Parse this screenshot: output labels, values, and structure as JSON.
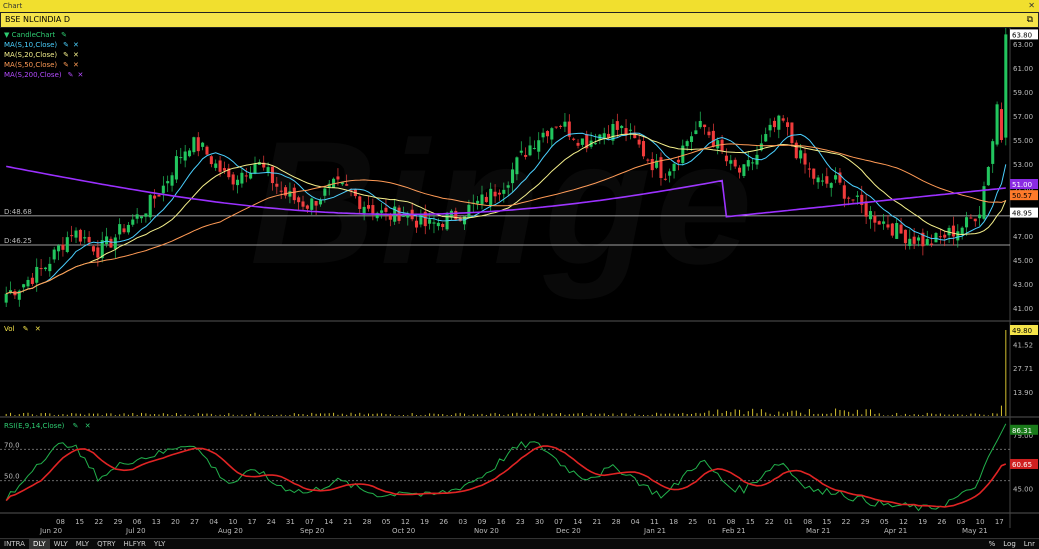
{
  "window": {
    "title": "Chart",
    "close_icon": "close-icon"
  },
  "symbol_bar": {
    "symbol": "BSE NLCINDIA D",
    "menu_icon": "window-menu-icon"
  },
  "watermark": "Binge",
  "price_panel": {
    "legend": [
      {
        "label": "CandleChart",
        "color": "#2ecc71",
        "prefix": "▼"
      },
      {
        "label": "MA(S,10,Close)",
        "color": "#4ad0ff"
      },
      {
        "label": "MA(S,20,Close)",
        "color": "#f5f08c"
      },
      {
        "label": "MA(S,50,Close)",
        "color": "#ff9a55"
      },
      {
        "label": "MA(S,200,Close)",
        "color": "#b44bff"
      }
    ],
    "hlines": [
      {
        "label": "D:48.68",
        "value": 48.68
      },
      {
        "label": "D:46.25",
        "value": 46.25
      }
    ],
    "yticks": [
      "63.00",
      "61.00",
      "59.00",
      "57.00",
      "55.00",
      "53.00",
      "51.00",
      "49.00",
      "47.00",
      "45.00",
      "43.00",
      "41.00"
    ],
    "tags": [
      {
        "text": "63.80",
        "bg": "#ffffff",
        "fg": "#000000"
      },
      {
        "text": "51.00",
        "bg": "#8a2be2",
        "fg": "#ffffff"
      },
      {
        "text": "50.57",
        "bg": "#ff7a2a",
        "fg": "#000000"
      },
      {
        "text": "48.95",
        "bg": "#ffffff",
        "fg": "#000000"
      }
    ]
  },
  "volume_panel": {
    "legend": "Vol",
    "yticks": [
      "41.52",
      "27.71",
      "13.90"
    ],
    "tag": {
      "text": "49.80",
      "bg": "#f5e44a",
      "fg": "#000000"
    }
  },
  "rsi_panel": {
    "legend": "RSI(E,9,14,Close)",
    "levels": [
      {
        "label": "70.0",
        "value": 70
      },
      {
        "label": "50.0",
        "value": 50
      }
    ],
    "yticks": [
      "79.00",
      "45.00"
    ],
    "tags": [
      {
        "text": "86.31",
        "bg": "#1a7a1a",
        "fg": "#ffffff"
      },
      {
        "text": "60.65",
        "bg": "#d02020",
        "fg": "#ffffff"
      }
    ]
  },
  "x_axis": {
    "day_labels": [
      "08",
      "15",
      "22",
      "29",
      "06",
      "13",
      "20",
      "27",
      "04",
      "10",
      "17",
      "24",
      "31",
      "07",
      "14",
      "21",
      "28",
      "05",
      "12",
      "19",
      "26",
      "03",
      "09",
      "16",
      "23",
      "30",
      "07",
      "14",
      "21",
      "28",
      "04",
      "11",
      "18",
      "25",
      "01",
      "08",
      "15",
      "22",
      "01",
      "08",
      "15",
      "22",
      "29",
      "05",
      "12",
      "19",
      "26",
      "03",
      "10",
      "17"
    ],
    "month_labels": [
      "Jun 20",
      "Jul 20",
      "Aug 20",
      "Sep 20",
      "Oct 20",
      "Nov 20",
      "Dec 20",
      "Jan 21",
      "Feb 21",
      "Mar 21",
      "Apr 21",
      "May 21"
    ]
  },
  "bottom_bar": {
    "timeframes": [
      "INTRA",
      "DLY",
      "WLY",
      "MLY",
      "QTRY",
      "HLFYR",
      "YLY"
    ],
    "active": "DLY",
    "right": [
      "%",
      "Log",
      "Lnr"
    ]
  },
  "chart_data": {
    "type": "candlestick",
    "x_range": [
      "Jun 20",
      "May 21"
    ],
    "price_ylim": [
      40.0,
      64.0
    ],
    "moving_averages": [
      "MA(S,10,Close)",
      "MA(S,20,Close)",
      "MA(S,50,Close)",
      "MA(S,200,Close)"
    ],
    "close_series": [
      42.2,
      42.8,
      43.6,
      44.5,
      46.0,
      47.4,
      46.8,
      45.8,
      46.6,
      47.8,
      48.6,
      49.8,
      51.2,
      53.4,
      54.8,
      54.2,
      52.8,
      51.6,
      52.4,
      53.2,
      52.0,
      50.6,
      50.0,
      49.6,
      50.4,
      51.2,
      50.8,
      49.8,
      49.2,
      48.6,
      49.0,
      48.4,
      47.8,
      48.2,
      48.6,
      49.2,
      49.8,
      50.6,
      51.6,
      53.4,
      54.8,
      55.8,
      56.6,
      55.6,
      54.8,
      55.4,
      56.0,
      55.8,
      54.6,
      53.2,
      52.2,
      53.6,
      55.4,
      56.2,
      54.6,
      52.8,
      52.2,
      53.6,
      55.6,
      56.6,
      54.2,
      52.4,
      51.2,
      51.6,
      50.4,
      49.4,
      48.6,
      48.0,
      47.2,
      46.8,
      46.4,
      46.8,
      47.4,
      48.0,
      49.2,
      55.0,
      63.8
    ],
    "ma_last": {
      "MA(S,200,Close)": 51.0,
      "MA(S,50,Close)": 50.57,
      "MA(S,10,Close)": 48.95
    },
    "volume_ylim": [
      0,
      49.8
    ],
    "volume_spikes": [
      {
        "x": "Feb 21",
        "value": 4.0
      },
      {
        "x": "Mar 21",
        "value": 5.0
      },
      {
        "x": "May 21",
        "value": 49.8
      }
    ],
    "rsi": {
      "ylim": [
        30,
        90
      ],
      "rsi_last": 86.31,
      "signal_last": 60.65,
      "rsi_series": [
        38,
        46,
        58,
        66,
        72,
        74,
        62,
        52,
        56,
        62,
        64,
        66,
        68,
        72,
        74,
        66,
        56,
        48,
        52,
        58,
        50,
        46,
        44,
        42,
        46,
        50,
        48,
        44,
        42,
        40,
        44,
        42,
        40,
        42,
        44,
        48,
        52,
        58,
        66,
        72,
        74,
        70,
        62,
        56,
        52,
        54,
        58,
        56,
        50,
        44,
        40,
        48,
        58,
        62,
        54,
        46,
        44,
        50,
        58,
        62,
        52,
        46,
        42,
        44,
        40,
        38,
        36,
        34,
        34,
        33,
        32,
        34,
        38,
        42,
        50,
        70,
        86
      ]
    }
  }
}
